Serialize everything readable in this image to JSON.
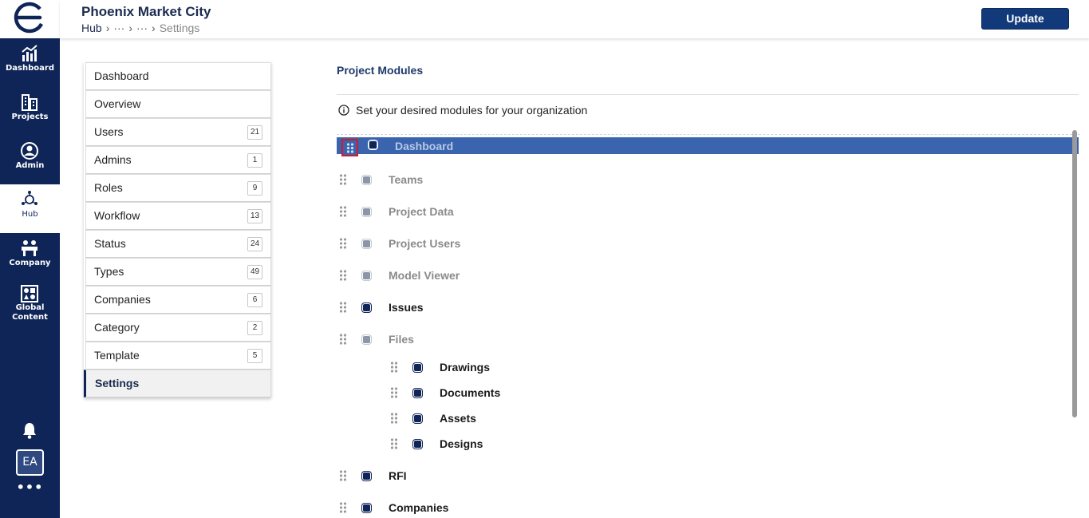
{
  "app": {
    "title": "Phoenix Market City",
    "breadcrumb": {
      "root": "Hub",
      "ellipsis1": "···",
      "ellipsis2": "···",
      "current": "Settings"
    },
    "update_label": "Update"
  },
  "rail": {
    "items": [
      {
        "label": "Dashboard",
        "icon": "chart-icon"
      },
      {
        "label": "Projects",
        "icon": "buildings-icon"
      },
      {
        "label": "Admin",
        "icon": "admin-icon"
      },
      {
        "label": "Hub",
        "icon": "hub-icon"
      },
      {
        "label": "Company",
        "icon": "company-icon"
      },
      {
        "label": "Global Content",
        "icon": "global-content-icon"
      }
    ],
    "avatar": "EA",
    "more": "•••",
    "colors": {
      "rail_bg": "#0f2557",
      "accent": "#123a7a"
    }
  },
  "menu": {
    "items": [
      {
        "label": "Dashboard",
        "count": ""
      },
      {
        "label": "Overview",
        "count": ""
      },
      {
        "label": "Users",
        "count": "21"
      },
      {
        "label": "Admins",
        "count": "1"
      },
      {
        "label": "Roles",
        "count": "9"
      },
      {
        "label": "Workflow",
        "count": "13"
      },
      {
        "label": "Status",
        "count": "24"
      },
      {
        "label": "Types",
        "count": "49"
      },
      {
        "label": "Companies",
        "count": "6"
      },
      {
        "label": "Category",
        "count": "2"
      },
      {
        "label": "Template",
        "count": "5"
      },
      {
        "label": "Settings",
        "count": ""
      }
    ],
    "active": "Settings"
  },
  "modules": {
    "title": "Project Modules",
    "info": "Set your desired modules for your organization",
    "items": [
      {
        "label": "Dashboard",
        "enabled": true,
        "selected": true
      },
      {
        "label": "Teams",
        "enabled": false
      },
      {
        "label": "Project Data",
        "enabled": false
      },
      {
        "label": "Project Users",
        "enabled": false
      },
      {
        "label": "Model Viewer",
        "enabled": false
      },
      {
        "label": "Issues",
        "enabled": true
      },
      {
        "label": "Files",
        "enabled": false
      },
      {
        "label": "Drawings",
        "enabled": true,
        "child": true
      },
      {
        "label": "Documents",
        "enabled": true,
        "child": true
      },
      {
        "label": "Assets",
        "enabled": true,
        "child": true
      },
      {
        "label": "Designs",
        "enabled": true,
        "child": true
      },
      {
        "label": "RFI",
        "enabled": true
      },
      {
        "label": "Companies",
        "enabled": true
      }
    ]
  }
}
